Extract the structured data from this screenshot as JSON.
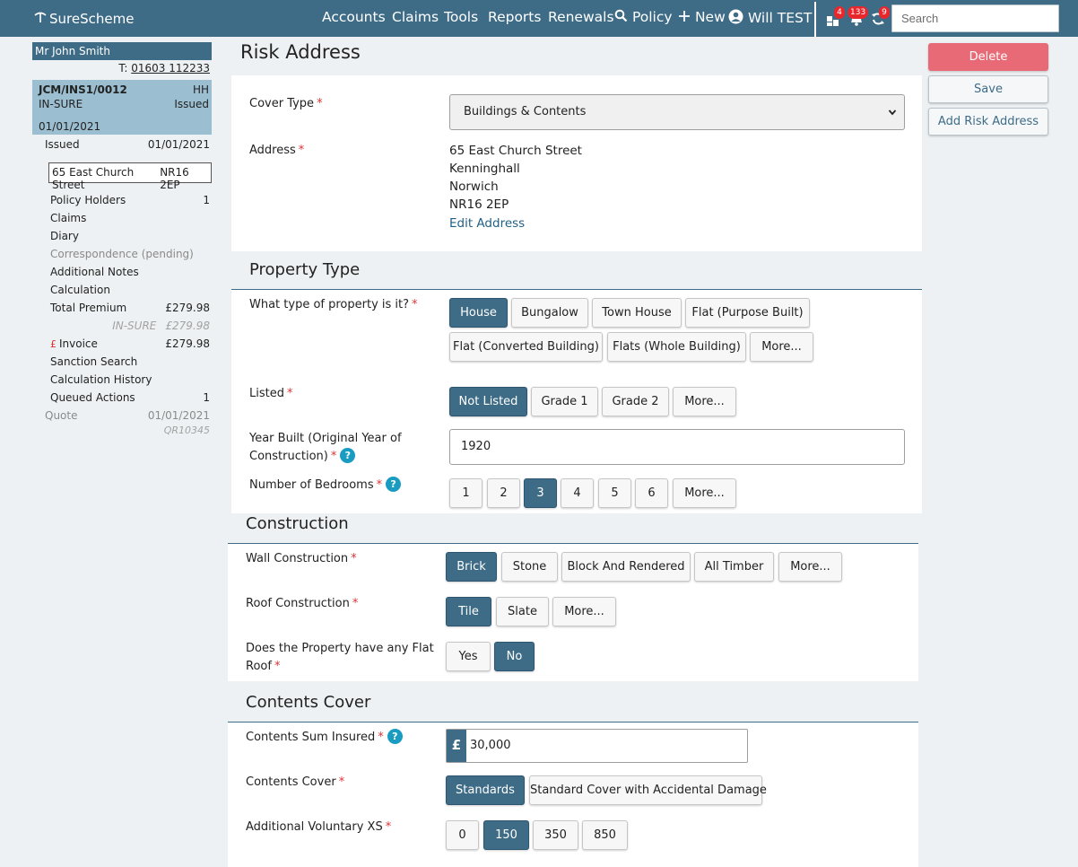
{
  "brand": {
    "name": "SureScheme"
  },
  "nav": {
    "accounts": "Accounts",
    "claims": "Claims",
    "tools": "Tools",
    "reports": "Reports",
    "renewals": "Renewals",
    "policy": "Policy",
    "new": "New",
    "user": "Will TEST"
  },
  "badges": {
    "tasks": "4",
    "notifications": "133",
    "sync": "9"
  },
  "search": {
    "placeholder": "Search",
    "value": ""
  },
  "sidebar": {
    "client_name": "Mr John Smith",
    "tel_prefix": "T:",
    "tel": "01603 112233",
    "policy": {
      "ref": "JCM/INS1/0012",
      "type": "HH",
      "insurer": "IN-SURE",
      "status": "Issued",
      "date": "01/01/2021"
    },
    "issued": {
      "label": "Issued",
      "date": "01/01/2021"
    },
    "address": {
      "street": "65 East Church Street",
      "postcode": "NR16 2EP"
    },
    "items": [
      {
        "label": "Policy Holders",
        "value": "1"
      },
      {
        "label": "Claims",
        "value": ""
      },
      {
        "label": "Diary",
        "value": ""
      },
      {
        "label": "Correspondence (pending)",
        "value": ""
      },
      {
        "label": "Additional Notes",
        "value": ""
      },
      {
        "label": "Calculation",
        "value": ""
      },
      {
        "label": "Total Premium",
        "value": "£279.98"
      }
    ],
    "insurer_premium": {
      "label": "IN-SURE",
      "value": "£279.98"
    },
    "invoice": {
      "icon": "£",
      "label": "Invoice",
      "value": "£279.98"
    },
    "items2": [
      {
        "label": "Sanction Search",
        "value": ""
      },
      {
        "label": "Calculation History",
        "value": ""
      },
      {
        "label": "Queued Actions",
        "value": "1"
      }
    ],
    "quote": {
      "label": "Quote",
      "date": "01/01/2021",
      "ref": "QR10345"
    }
  },
  "page": {
    "title": "Risk Address"
  },
  "actions": {
    "delete": "Delete",
    "save": "Save",
    "add_risk": "Add Risk Address"
  },
  "risk": {
    "cover_type_label": "Cover Type",
    "cover_type_value": "Buildings & Contents",
    "address_label": "Address",
    "address_lines": [
      "65 East Church Street",
      "Kenninghall",
      "Norwich",
      "NR16 2EP"
    ],
    "edit_address": "Edit Address"
  },
  "property": {
    "title": "Property Type",
    "type_label": "What type of property is it?",
    "types": [
      "House",
      "Bungalow",
      "Town House",
      "Flat (Purpose Built)",
      "Flat (Converted Building)",
      "Flats (Whole Building)",
      "More..."
    ],
    "listed_label": "Listed",
    "listed": [
      "Not Listed",
      "Grade 1",
      "Grade 2",
      "More..."
    ],
    "year_label_1": "Year Built (Original Year of",
    "year_label_2": "Construction)",
    "year_value": "1920",
    "bedrooms_label": "Number of Bedrooms",
    "bedrooms": [
      "1",
      "2",
      "3",
      "4",
      "5",
      "6",
      "More..."
    ]
  },
  "construction": {
    "title": "Construction",
    "wall_label": "Wall Construction",
    "walls": [
      "Brick",
      "Stone",
      "Block And Rendered",
      "All Timber",
      "More..."
    ],
    "roof_label": "Roof Construction",
    "roofs": [
      "Tile",
      "Slate",
      "More..."
    ],
    "flat_label_1": "Does the Property have any Flat",
    "flat_label_2": "Roof",
    "flat": [
      "Yes",
      "No"
    ]
  },
  "contents": {
    "title": "Contents Cover",
    "sum_label": "Contents Sum Insured",
    "currency": "£",
    "sum_value": "30,000",
    "cover_label": "Contents Cover",
    "covers": [
      "Standards",
      "Standard Cover with Accidental Damage"
    ],
    "xs_label": "Additional Voluntary XS",
    "xs": [
      "0",
      "150",
      "350",
      "850"
    ]
  },
  "help_glyph": "?",
  "required_mark": "*",
  "chevron": "❯"
}
